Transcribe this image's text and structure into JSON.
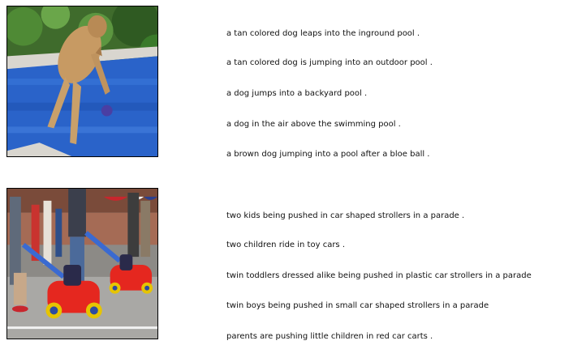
{
  "examples": [
    {
      "image": {
        "description": "photo of dog jumping into pool"
      },
      "captions": [
        "a tan colored dog leaps into the inground pool .",
        "a tan colored dog is jumping into an outdoor pool .",
        "a dog jumps into a backyard pool .",
        "a dog in the air above the swimming pool .",
        "a brown dog jumping into a pool after a bloe ball ."
      ]
    },
    {
      "image": {
        "description": "photo of parade with toddlers in red car strollers"
      },
      "captions": [
        "two kids being pushed in car shaped strollers in a parade .",
        "two children ride in toy cars .",
        "twin toddlers dressed alike being pushed in plastic car strollers in a parade",
        "twin boys being pushed in small car shaped strollers in a parade",
        "parents are pushing little children in red car carts ."
      ]
    }
  ]
}
